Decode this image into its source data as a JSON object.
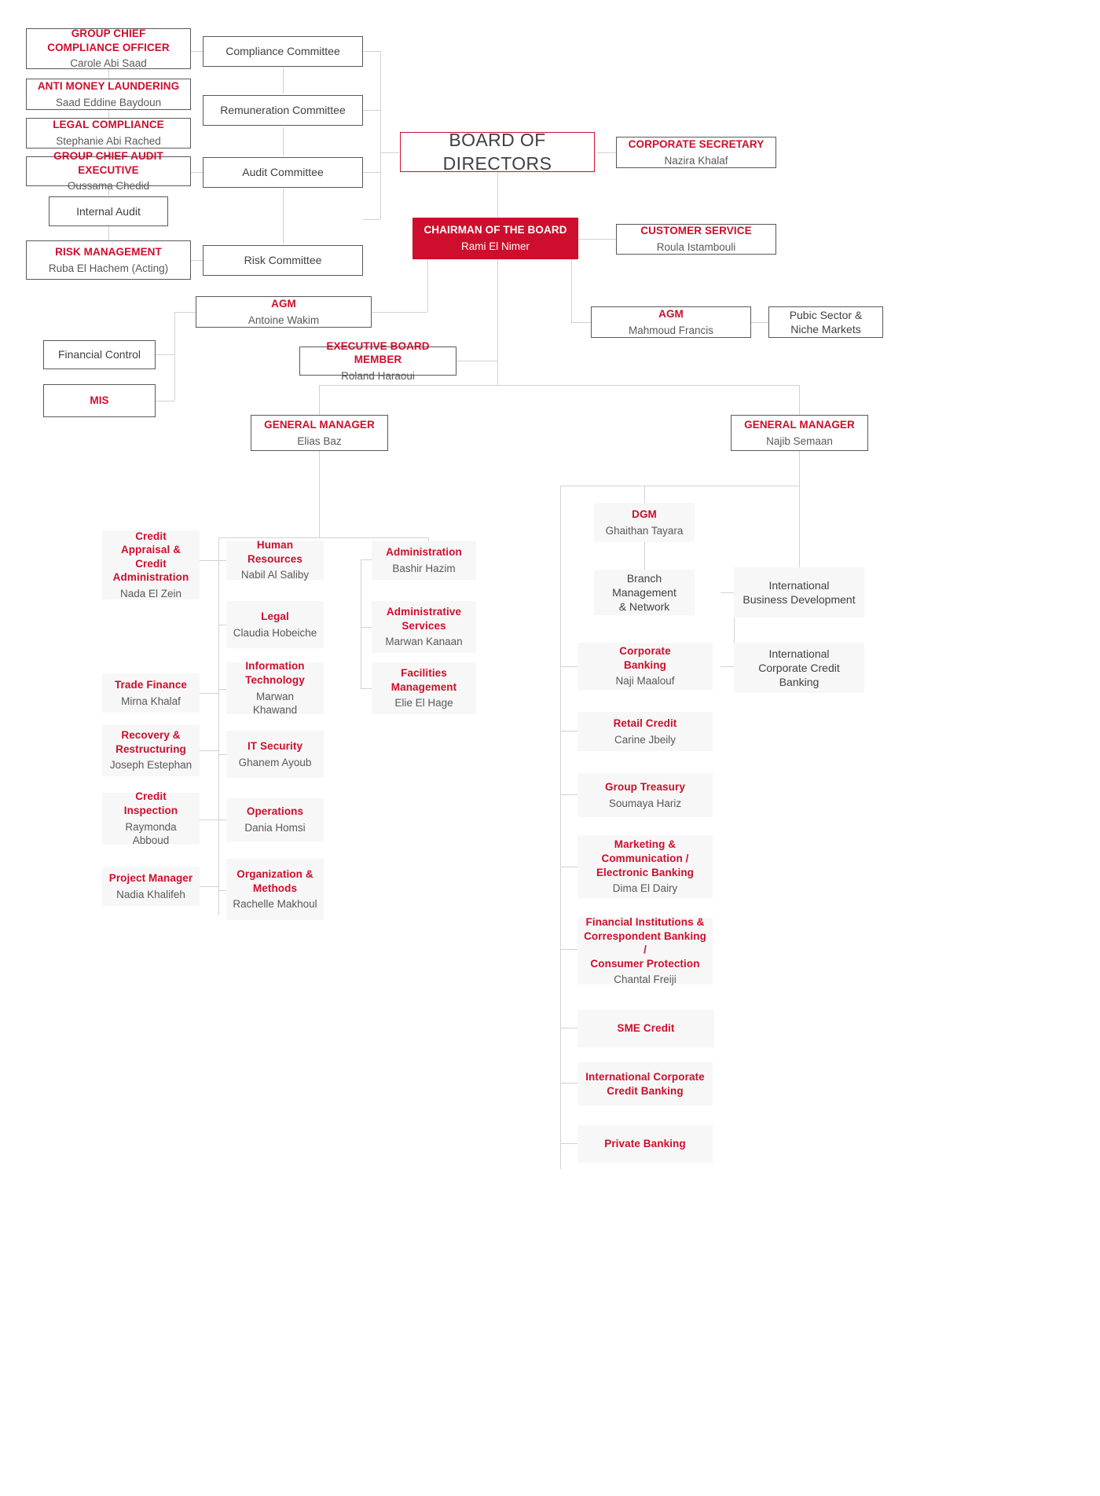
{
  "colors": {
    "accent_red": "#ce0e2d",
    "text_gray": "#58595b",
    "text_dark": "#414042",
    "box_shade": "#f7f7f7",
    "line": "#d2d2d4",
    "border": "#58595b"
  },
  "board": {
    "title": "BOARD OF DIRECTORS"
  },
  "chairman": {
    "title": "CHAIRMAN OF THE BOARD",
    "name": "Rami El Nimer"
  },
  "committees": [
    {
      "label": "Compliance Committee"
    },
    {
      "label": "Remuneration Committee"
    },
    {
      "label": "Audit Committee"
    },
    {
      "label": "Risk Committee"
    }
  ],
  "control_functions": [
    {
      "title": "GROUP CHIEF COMPLIANCE OFFICER",
      "name": "Carole Abi Saad"
    },
    {
      "title": "ANTI MONEY LAUNDERING",
      "name": "Saad Eddine Baydoun"
    },
    {
      "title": "LEGAL COMPLIANCE",
      "name": "Stephanie Abi Rached"
    },
    {
      "title": "GROUP CHIEF AUDIT EXECUTIVE",
      "name": "Oussama Chedid"
    },
    {
      "title": "Internal Audit",
      "name": ""
    },
    {
      "title": "RISK MANAGEMENT",
      "name": "Ruba El Hachem (Acting)"
    }
  ],
  "board_support": [
    {
      "title": "CORPORATE SECRETARY",
      "name": "Nazira Khalaf"
    },
    {
      "title": "CUSTOMER SERVICE",
      "name": "Roula Istambouli"
    }
  ],
  "agm_left": {
    "title": "AGM",
    "name": "Antoine Wakim"
  },
  "agm_right": {
    "title": "AGM",
    "name": "Mahmoud Francis"
  },
  "public_sector": {
    "label": "Pubic Sector &\nNiche Markets",
    "line1": "Pubic Sector &",
    "line2": "Niche Markets"
  },
  "financial_units": [
    {
      "title": "Financial Control",
      "name": ""
    },
    {
      "title": "MIS",
      "name": ""
    }
  ],
  "executive_board_member": {
    "title": "EXECUTIVE BOARD MEMBER",
    "name": "Roland Haraoui"
  },
  "general_manager_left": {
    "title": "GENERAL MANAGER",
    "name": "Elias Baz"
  },
  "general_manager_right": {
    "title": "GENERAL MANAGER",
    "name": "Najib Semaan"
  },
  "gm_left_col1": [
    {
      "title": "Credit\nAppraisal & Credit\nAdministration",
      "title_lines": [
        "Credit",
        "Appraisal & Credit",
        "Administration"
      ],
      "name": "Nada El Zein"
    },
    {
      "title": "Trade Finance",
      "title_lines": [
        "Trade Finance"
      ],
      "name": "Mirna Khalaf"
    },
    {
      "title": "Recovery &\nRestructuring",
      "title_lines": [
        "Recovery &",
        "Restructuring"
      ],
      "name": "Joseph Estephan"
    },
    {
      "title": "Credit\nInspection",
      "title_lines": [
        "Credit",
        "Inspection"
      ],
      "name": "Raymonda Abboud"
    },
    {
      "title": "Project Manager",
      "title_lines": [
        "Project Manager"
      ],
      "name": "Nadia Khalifeh"
    }
  ],
  "gm_left_col2": [
    {
      "title_lines": [
        "Human Resources"
      ],
      "name": "Nabil Al Saliby"
    },
    {
      "title_lines": [
        "Legal"
      ],
      "name": "Claudia Hobeiche"
    },
    {
      "title_lines": [
        "Information",
        "Technology"
      ],
      "name": "Marwan Khawand"
    },
    {
      "title_lines": [
        "IT Security"
      ],
      "name": "Ghanem Ayoub"
    },
    {
      "title_lines": [
        "Operations"
      ],
      "name": "Dania Homsi"
    },
    {
      "title_lines": [
        "Organization &",
        "Methods"
      ],
      "name": "Rachelle Makhoul"
    }
  ],
  "gm_left_col3": [
    {
      "title_lines": [
        "Administration"
      ],
      "name": "Bashir Hazim"
    },
    {
      "title_lines": [
        "Administrative",
        "Services"
      ],
      "name": "Marwan Kanaan"
    },
    {
      "title_lines": [
        "Facilities",
        "Management"
      ],
      "name": "Elie El Hage"
    }
  ],
  "dgm": {
    "title": "DGM",
    "name": "Ghaithan Tayara"
  },
  "branch_management": {
    "line1": "Branch",
    "line2": "Management",
    "line3": "& Network"
  },
  "gm_right_col": [
    {
      "title_lines": [
        "Corporate",
        "Banking"
      ],
      "name": "Naji Maalouf"
    },
    {
      "title_lines": [
        "Retail Credit"
      ],
      "name": "Carine Jbeily"
    },
    {
      "title_lines": [
        "Group Treasury"
      ],
      "name": "Soumaya Hariz"
    },
    {
      "title_lines": [
        "Marketing &",
        "Communication /",
        "Electronic Banking"
      ],
      "name": "Dima El Dairy"
    },
    {
      "title_lines": [
        "Financial Institutions &",
        "Correspondent Banking /",
        "Consumer Protection"
      ],
      "name": "Chantal Freiji"
    },
    {
      "title_lines": [
        "SME Credit"
      ],
      "name": ""
    },
    {
      "title_lines": [
        "International Corporate",
        "Credit Banking"
      ],
      "name": ""
    },
    {
      "title_lines": [
        "Private Banking"
      ],
      "name": ""
    }
  ],
  "international": [
    {
      "line1": "International",
      "line2": "Business Development"
    },
    {
      "line1": "International",
      "line2": "Corporate Credit Banking"
    }
  ]
}
